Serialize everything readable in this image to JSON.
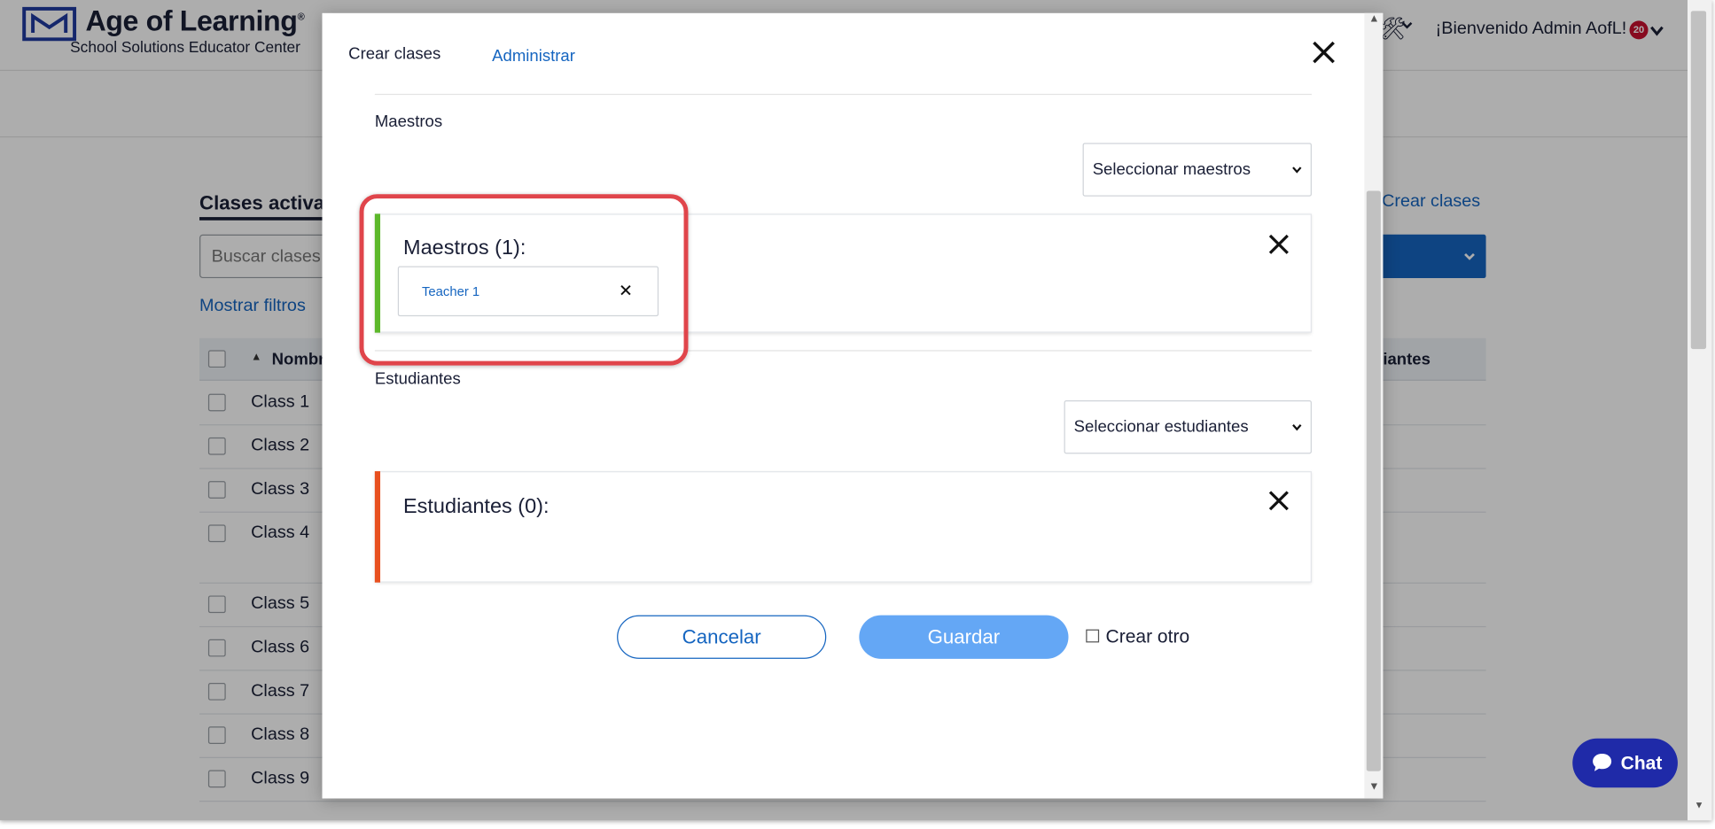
{
  "header": {
    "brand_title": "Age of Learning",
    "brand_reg": "®",
    "brand_subtitle": "School Solutions Educator Center",
    "tool_icon": "tools-icon",
    "welcome_text": "¡Bienvenido Admin AofL!",
    "notification_count": "20"
  },
  "background_page": {
    "title": "Clases activa",
    "search_placeholder": "Buscar clases",
    "show_filters": "Mostrar filtros",
    "create_link": "Crear clases",
    "table": {
      "col_name": "Nombr",
      "col_right": "iantes",
      "rows": [
        "Class 1",
        "Class 2",
        "Class 3",
        "Class 4",
        "Class 5",
        "Class 6",
        "Class 7",
        "Class 8",
        "Class 9"
      ]
    },
    "chat_label": "Chat"
  },
  "modal": {
    "tabs": {
      "create": "Crear clases",
      "manage": "Administrar"
    },
    "teachers": {
      "section_label": "Maestros",
      "select_placeholder": "Seleccionar maestros",
      "panel_title": "Maestros (1):",
      "selected": [
        "Teacher 1"
      ]
    },
    "students": {
      "section_label": "Estudiantes",
      "select_placeholder": "Seleccionar estudiantes",
      "panel_title": "Estudiantes (0):"
    },
    "actions": {
      "cancel": "Cancelar",
      "save": "Guardar",
      "create_another": "Crear otro",
      "create_another_checked": false
    }
  },
  "colors": {
    "accent_blue": "#1565c0",
    "save_button": "#64a7f5",
    "teachers_bar": "#5cb82a",
    "students_bar": "#e8501f",
    "highlight": "#e0454b",
    "chat": "#1f2aa8",
    "badge": "#c8102e"
  }
}
